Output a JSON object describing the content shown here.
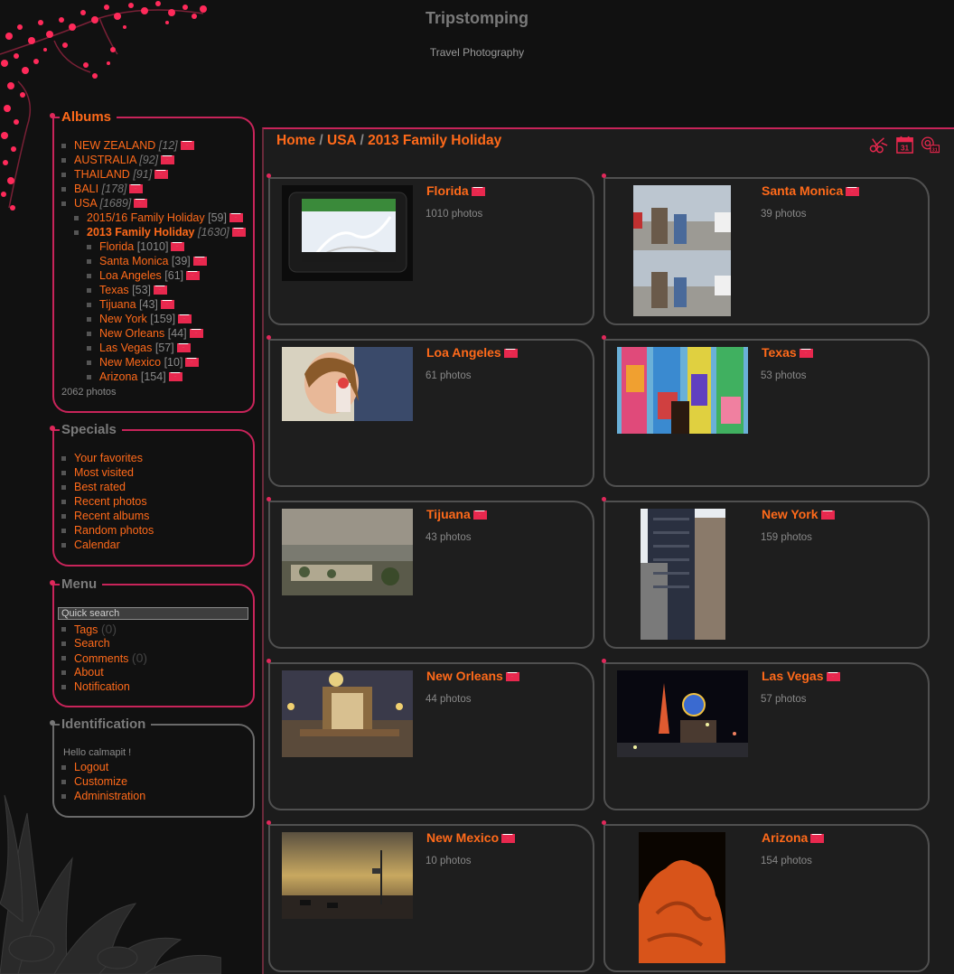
{
  "site": {
    "title": "Tripstomping",
    "subtitle": "Travel Photography"
  },
  "colors": {
    "accent": "#ff6a1a",
    "border": "#c8245a",
    "background": "#111111"
  },
  "albums": {
    "title": "Albums",
    "items": [
      {
        "label": "NEW ZEALAND",
        "count": "[12]"
      },
      {
        "label": "AUSTRALIA",
        "count": "[92]"
      },
      {
        "label": "THAILAND",
        "count": "[91]"
      },
      {
        "label": "BALI",
        "count": "[178]"
      },
      {
        "label": "USA",
        "count": "[1689]"
      }
    ],
    "sub": [
      {
        "label": "2015/16 Family Holiday",
        "count": "[59]"
      },
      {
        "label": "2013 Family Holiday",
        "count": "[1630]"
      }
    ],
    "subsub": [
      {
        "label": "Florida",
        "count": "[1010]"
      },
      {
        "label": "Santa Monica",
        "count": "[39]"
      },
      {
        "label": "Loa Angeles",
        "count": "[61]"
      },
      {
        "label": "Texas",
        "count": "[53]"
      },
      {
        "label": "Tijuana",
        "count": "[43]"
      },
      {
        "label": "New York",
        "count": "[159]"
      },
      {
        "label": "New Orleans",
        "count": "[44]"
      },
      {
        "label": "Las Vegas",
        "count": "[57]"
      },
      {
        "label": "New Mexico",
        "count": "[10]"
      },
      {
        "label": "Arizona",
        "count": "[154]"
      }
    ],
    "total": "2062 photos"
  },
  "specials": {
    "title": "Specials",
    "items": [
      "Your favorites",
      "Most visited",
      "Best rated",
      "Recent photos",
      "Recent albums",
      "Random photos",
      "Calendar"
    ]
  },
  "menu": {
    "title": "Menu",
    "search_placeholder": "Quick search",
    "items": [
      {
        "label": "Tags",
        "count": "(0)"
      },
      {
        "label": "Search",
        "count": ""
      },
      {
        "label": "Comments",
        "count": "(0)"
      },
      {
        "label": "About",
        "count": ""
      },
      {
        "label": "Notification",
        "count": ""
      }
    ]
  },
  "identification": {
    "title": "Identification",
    "greeting": "Hello calmapit !",
    "items": [
      "Logout",
      "Customize",
      "Administration"
    ]
  },
  "breadcrumb": {
    "home": "Home",
    "sep1": " / ",
    "level1": "USA",
    "sep2": " / ",
    "current": "2013 Family Holiday"
  },
  "albums_grid": [
    {
      "title": "Florida",
      "count": "1010 photos"
    },
    {
      "title": "Santa Monica",
      "count": "39 photos"
    },
    {
      "title": "Loa Angeles",
      "count": "61 photos"
    },
    {
      "title": "Texas",
      "count": "53 photos"
    },
    {
      "title": "Tijuana",
      "count": "43 photos"
    },
    {
      "title": "New York",
      "count": "159 photos"
    },
    {
      "title": "New Orleans",
      "count": "44 photos"
    },
    {
      "title": "Las Vegas",
      "count": "57 photos"
    },
    {
      "title": "New Mexico",
      "count": "10 photos"
    },
    {
      "title": "Arizona",
      "count": "154 photos"
    }
  ],
  "toolbar_icons": {
    "day": "31",
    "cal": "31"
  }
}
